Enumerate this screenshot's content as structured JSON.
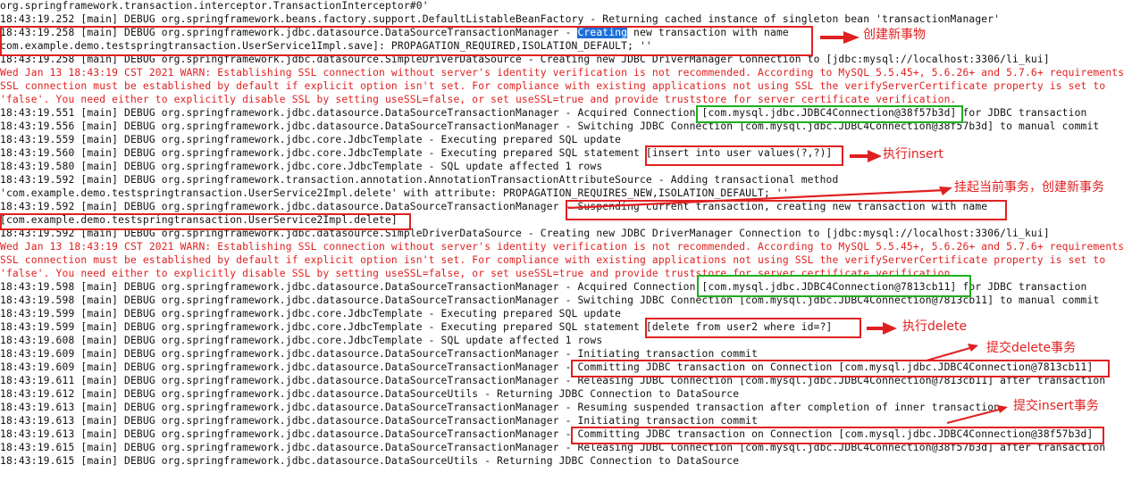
{
  "log_lines": [
    {
      "text": "org.springframework.transaction.interceptor.TransactionInterceptor#0'",
      "level": "debug"
    },
    {
      "text": "18:43:19.252 [main] DEBUG org.springframework.beans.factory.support.DefaultListableBeanFactory - Returning cached instance of singleton bean 'transactionManager'",
      "level": "debug"
    },
    {
      "pre": "18:43:19.258 [main] DEBUG org.springframework.jdbc.datasource.DataSourceTransactionManager - ",
      "selected": "Creating",
      "post": " new transaction with name",
      "level": "debug"
    },
    {
      "text": "com.example.demo.testspringtransaction.UserService1Impl.save]: PROPAGATION_REQUIRED,ISOLATION_DEFAULT; ''",
      "level": "debug"
    },
    {
      "text": "18:43:19.258 [main] DEBUG org.springframework.jdbc.datasource.SimpleDriverDataSource - Creating new JDBC DriverManager Connection to [jdbc:mysql://localhost:3306/li_kui]",
      "level": "debug"
    },
    {
      "text": "Wed Jan 13 18:43:19 CST 2021 WARN: Establishing SSL connection without server's identity verification is not recommended. According to MySQL 5.5.45+, 5.6.26+ and 5.7.6+ requirements",
      "level": "warn"
    },
    {
      "text": "SSL connection must be established by default if explicit option isn't set. For compliance with existing applications not using SSL the verifyServerCertificate property is set to",
      "level": "warn"
    },
    {
      "text": "'false'. You need either to explicitly disable SSL by setting useSSL=false, or set useSSL=true and provide truststore for server certificate verification.",
      "level": "warn"
    },
    {
      "text": "18:43:19.551 [main] DEBUG org.springframework.jdbc.datasource.DataSourceTransactionManager - Acquired Connection [com.mysql.jdbc.JDBC4Connection@38f57b3d] for JDBC transaction",
      "level": "debug"
    },
    {
      "text": "18:43:19.556 [main] DEBUG org.springframework.jdbc.datasource.DataSourceTransactionManager - Switching JDBC Connection [com.mysql.jdbc.JDBC4Connection@38f57b3d] to manual commit",
      "level": "debug"
    },
    {
      "text": "18:43:19.559 [main] DEBUG org.springframework.jdbc.core.JdbcTemplate - Executing prepared SQL update",
      "level": "debug"
    },
    {
      "text": "18:43:19.560 [main] DEBUG org.springframework.jdbc.core.JdbcTemplate - Executing prepared SQL statement [insert into user values(?,?)]",
      "level": "debug"
    },
    {
      "text": "18:43:19.580 [main] DEBUG org.springframework.jdbc.core.JdbcTemplate - SQL update affected 1 rows",
      "level": "debug"
    },
    {
      "text": "18:43:19.592 [main] DEBUG org.springframework.transaction.annotation.AnnotationTransactionAttributeSource - Adding transactional method",
      "level": "debug"
    },
    {
      "text": "'com.example.demo.testspringtransaction.UserService2Impl.delete' with attribute: PROPAGATION_REQUIRES_NEW,ISOLATION_DEFAULT; ''",
      "level": "debug"
    },
    {
      "text": "18:43:19.592 [main] DEBUG org.springframework.jdbc.datasource.DataSourceTransactionManager - Suspending current transaction, creating new transaction with name",
      "level": "debug"
    },
    {
      "text": "[com.example.demo.testspringtransaction.UserService2Impl.delete]",
      "level": "debug"
    },
    {
      "text": "18:43:19.592 [main] DEBUG org.springframework.jdbc.datasource.SimpleDriverDataSource - Creating new JDBC DriverManager Connection to [jdbc:mysql://localhost:3306/li_kui]",
      "level": "debug"
    },
    {
      "text": "Wed Jan 13 18:43:19 CST 2021 WARN: Establishing SSL connection without server's identity verification is not recommended. According to MySQL 5.5.45+, 5.6.26+ and 5.7.6+ requirements",
      "level": "warn"
    },
    {
      "text": "SSL connection must be established by default if explicit option isn't set. For compliance with existing applications not using SSL the verifyServerCertificate property is set to",
      "level": "warn"
    },
    {
      "text": "'false'. You need either to explicitly disable SSL by setting useSSL=false, or set useSSL=true and provide truststore for server certificate verification.",
      "level": "warn"
    },
    {
      "text": "18:43:19.598 [main] DEBUG org.springframework.jdbc.datasource.DataSourceTransactionManager - Acquired Connection [com.mysql.jdbc.JDBC4Connection@7813cb11] for JDBC transaction",
      "level": "debug"
    },
    {
      "text": "18:43:19.598 [main] DEBUG org.springframework.jdbc.datasource.DataSourceTransactionManager - Switching JDBC Connection [com.mysql.jdbc.JDBC4Connection@7813cb11] to manual commit",
      "level": "debug"
    },
    {
      "text": "18:43:19.599 [main] DEBUG org.springframework.jdbc.core.JdbcTemplate - Executing prepared SQL update",
      "level": "debug"
    },
    {
      "text": "18:43:19.599 [main] DEBUG org.springframework.jdbc.core.JdbcTemplate - Executing prepared SQL statement [delete from user2 where id=?]",
      "level": "debug"
    },
    {
      "text": "18:43:19.608 [main] DEBUG org.springframework.jdbc.core.JdbcTemplate - SQL update affected 1 rows",
      "level": "debug"
    },
    {
      "text": "18:43:19.609 [main] DEBUG org.springframework.jdbc.datasource.DataSourceTransactionManager - Initiating transaction commit",
      "level": "debug"
    },
    {
      "text": "18:43:19.609 [main] DEBUG org.springframework.jdbc.datasource.DataSourceTransactionManager - Committing JDBC transaction on Connection [com.mysql.jdbc.JDBC4Connection@7813cb11]",
      "level": "debug"
    },
    {
      "text": "18:43:19.611 [main] DEBUG org.springframework.jdbc.datasource.DataSourceTransactionManager - Releasing JDBC Connection [com.mysql.jdbc.JDBC4Connection@7813cb11] after transaction",
      "level": "debug"
    },
    {
      "text": "18:43:19.612 [main] DEBUG org.springframework.jdbc.datasource.DataSourceUtils - Returning JDBC Connection to DataSource",
      "level": "debug"
    },
    {
      "text": "18:43:19.613 [main] DEBUG org.springframework.jdbc.datasource.DataSourceTransactionManager - Resuming suspended transaction after completion of inner transaction",
      "level": "debug"
    },
    {
      "text": "18:43:19.613 [main] DEBUG org.springframework.jdbc.datasource.DataSourceTransactionManager - Initiating transaction commit",
      "level": "debug"
    },
    {
      "text": "18:43:19.613 [main] DEBUG org.springframework.jdbc.datasource.DataSourceTransactionManager - Committing JDBC transaction on Connection [com.mysql.jdbc.JDBC4Connection@38f57b3d]",
      "level": "debug"
    },
    {
      "text": "18:43:19.615 [main] DEBUG org.springframework.jdbc.datasource.DataSourceTransactionManager - Releasing JDBC Connection [com.mysql.jdbc.JDBC4Connection@38f57b3d] after transaction",
      "level": "debug"
    },
    {
      "text": "18:43:19.615 [main] DEBUG org.springframework.jdbc.datasource.DataSourceUtils - Returning JDBC Connection to DataSource",
      "level": "debug"
    }
  ],
  "annotations": {
    "create_transaction": "创建新事物",
    "execute_insert": "执行insert",
    "suspend_and_create": "挂起当前事务，创建新事务",
    "execute_delete": "执行delete",
    "commit_delete": "提交delete事务",
    "commit_insert": "提交insert事务"
  },
  "colors": {
    "log_text": "#111111",
    "warn_text": "#e02020",
    "annotation_red": "#e02020",
    "box_green": "#1eb01e",
    "selection_blue": "#1e6fd9"
  }
}
